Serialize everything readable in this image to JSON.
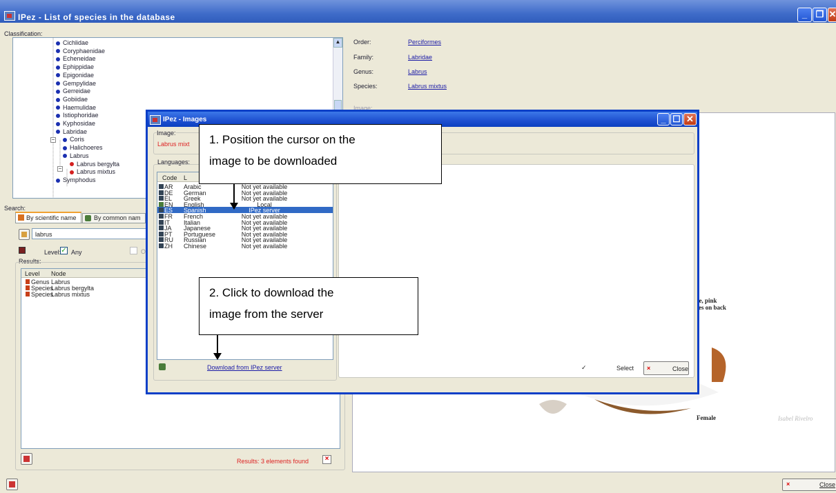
{
  "main_window": {
    "title": "IPez - List of species in the database",
    "classification_label": "Classification:",
    "search_label": "Search:",
    "results_label": "Results:",
    "image_label": "Image:",
    "close_label": "Close"
  },
  "tree": [
    {
      "label": "Cichlidae",
      "color": "blue"
    },
    {
      "label": "Coryphaenidae",
      "color": "blue"
    },
    {
      "label": "Echeneidae",
      "color": "blue"
    },
    {
      "label": "Ephippidae",
      "color": "blue"
    },
    {
      "label": "Epigonidae",
      "color": "blue"
    },
    {
      "label": "Gempylidae",
      "color": "blue"
    },
    {
      "label": "Gerreidae",
      "color": "blue"
    },
    {
      "label": "Gobiidae",
      "color": "blue"
    },
    {
      "label": "Haemulidae",
      "color": "blue"
    },
    {
      "label": "Istiophoridae",
      "color": "blue"
    },
    {
      "label": "Kyphosidae",
      "color": "blue"
    },
    {
      "label": "Labridae",
      "color": "blue"
    },
    {
      "label": "Coris",
      "color": "blue"
    },
    {
      "label": "Halichoeres",
      "color": "blue"
    },
    {
      "label": "Labrus",
      "color": "blue"
    },
    {
      "label": "Labrus bergylta",
      "color": "red"
    },
    {
      "label": "Labrus mixtus",
      "color": "red"
    },
    {
      "label": "Symphodus",
      "color": "blue"
    }
  ],
  "details": {
    "order_label": "Order:",
    "order_value": "Perciformes",
    "family_label": "Family:",
    "family_value": "Labridae",
    "genus_label": "Genus:",
    "genus_value": "Labrus",
    "species_label": "Species:",
    "species_value": "Labrus mixtus"
  },
  "search": {
    "tab_scientific": "By scientific name",
    "tab_common": "By common nam",
    "query": "labrus",
    "level_label": "Level:",
    "level_any": "Any",
    "level_other": "O"
  },
  "results": {
    "headers": [
      "Level",
      "Node"
    ],
    "rows": [
      [
        "Genus",
        "Labrus"
      ],
      [
        "Species",
        "Labrus bergylta"
      ],
      [
        "Species",
        "Labrus mixtus"
      ]
    ],
    "footer": "Results: 3 elements found"
  },
  "fish_image": {
    "caption_female": "Female",
    "credit": "Isabel Rivelro",
    "partial_e": "e",
    "partial_text1": "nge, pink",
    "partial_text2": "ches on back"
  },
  "dialog": {
    "title": "IPez - Images",
    "image_label": "Image:",
    "image_value": "Labrus mixt",
    "languages_label": "Languages:",
    "headers": [
      "Code",
      "L"
    ],
    "languages": [
      {
        "code": "AR",
        "name": "Arabic",
        "status": "Not yet available"
      },
      {
        "code": "DE",
        "name": "German",
        "status": "Not yet available"
      },
      {
        "code": "EL",
        "name": "Greek",
        "status": "Not yet available"
      },
      {
        "code": "EN",
        "name": "English",
        "status": "Local"
      },
      {
        "code": "ES",
        "name": "Spanish",
        "status": "IPez server"
      },
      {
        "code": "FR",
        "name": "French",
        "status": "Not yet available"
      },
      {
        "code": "IT",
        "name": "Italian",
        "status": "Not yet available"
      },
      {
        "code": "JA",
        "name": "Japanese",
        "status": "Not yet available"
      },
      {
        "code": "PT",
        "name": "Portuguese",
        "status": "Not yet available"
      },
      {
        "code": "RU",
        "name": "Russian",
        "status": "Not yet available"
      },
      {
        "code": "ZH",
        "name": "Chinese",
        "status": "Not yet available"
      }
    ],
    "download_link": "Download from IPez server",
    "select_label": "Select",
    "close_label": "Close"
  },
  "callouts": {
    "first": [
      "1. Position the cursor on the",
      "image to be downloaded"
    ],
    "second": [
      "2. Click to download the",
      "image from the server"
    ]
  }
}
